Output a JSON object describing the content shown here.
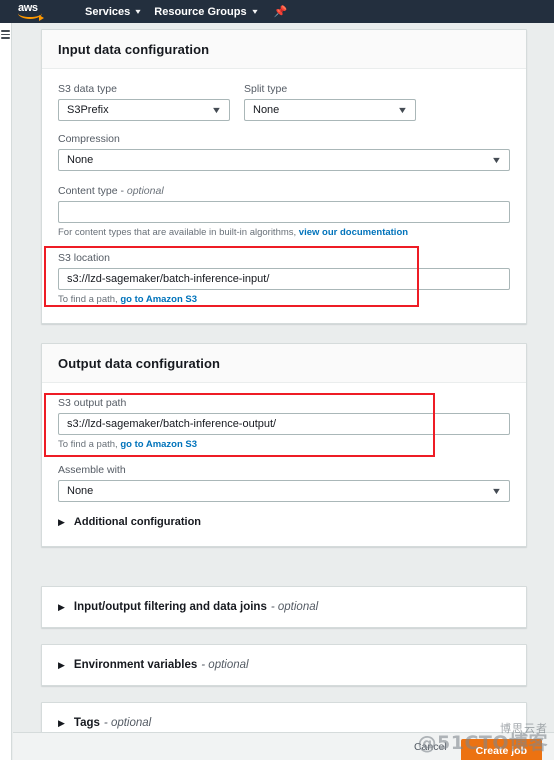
{
  "topnav": {
    "logo_text": "aws",
    "logo_icon": "aws-smile-logo",
    "services_label": "Services",
    "resource_groups_label": "Resource Groups",
    "pin_icon": "pin-icon",
    "caret_icon": "chevron-down-icon",
    "background": "#232f3e"
  },
  "rail": {
    "menu_icon": "hamburger-menu-icon"
  },
  "input_data": {
    "title": "Input data configuration",
    "s3_data_type": {
      "label": "S3 data type",
      "value": "S3Prefix"
    },
    "split_type": {
      "label": "Split type",
      "value": "None"
    },
    "compression": {
      "label": "Compression",
      "value": "None"
    },
    "content_type": {
      "label": "Content type - ",
      "label_optional": "optional",
      "value": "",
      "placeholder": "",
      "hint_text": "For content types that are available in built-in algorithms, ",
      "hint_link": "view our documentation"
    },
    "s3_location": {
      "label": "S3 location",
      "value": "s3://lzd-sagemaker/batch-inference-input/",
      "hint_text": "To find a path, ",
      "hint_link": "go to Amazon S3"
    }
  },
  "output_data": {
    "title": "Output data configuration",
    "s3_output_path": {
      "label": "S3 output path",
      "value": "s3://lzd-sagemaker/batch-inference-output/",
      "hint_text": "To find a path, ",
      "hint_link": "go to Amazon S3"
    },
    "assemble_with": {
      "label": "Assemble with",
      "value": "None"
    },
    "additional_configuration": {
      "label": "Additional configuration",
      "icon": "triangle-right-icon"
    }
  },
  "collapsed_sections": [
    {
      "label": "Input/output filtering and data joins",
      "optional": "- optional",
      "icon": "triangle-right-icon"
    },
    {
      "label": "Environment variables",
      "optional": "- optional",
      "icon": "triangle-right-icon"
    },
    {
      "label": "Tags",
      "optional": "- optional",
      "icon": "triangle-right-icon"
    }
  ],
  "footer": {
    "cancel_label": "Cancel",
    "create_label": "Create job",
    "primary_color": "#ec7211"
  },
  "watermark": {
    "top_text": "博思云者",
    "main_text": "@51CTO博客"
  },
  "highlights": {
    "color": "#ee1c25"
  }
}
